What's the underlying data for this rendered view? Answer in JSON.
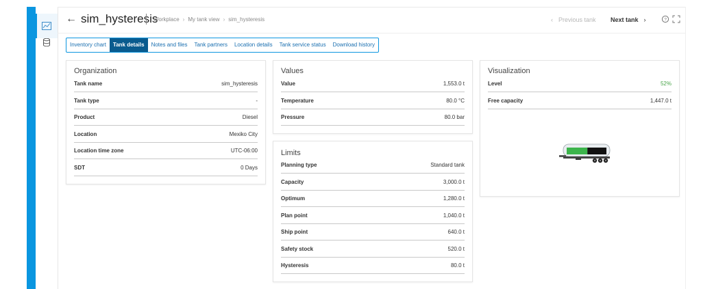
{
  "header": {
    "back_icon": "arrow-left-icon",
    "title": "sim_hysteresis",
    "breadcrumb": [
      "Workplace",
      "My tank view",
      "sim_hysteresis"
    ],
    "prev_label": "Previous tank",
    "next_label": "Next tank",
    "icons": [
      "help-icon",
      "fullscreen-icon"
    ]
  },
  "rail": {
    "icons": [
      "chart-icon",
      "database-icon"
    ]
  },
  "tabs": [
    {
      "label": "Inventory chart",
      "active": false
    },
    {
      "label": "Tank details",
      "active": true
    },
    {
      "label": "Notes and files",
      "active": false
    },
    {
      "label": "Tank partners",
      "active": false
    },
    {
      "label": "Location details",
      "active": false
    },
    {
      "label": "Tank service status",
      "active": false
    },
    {
      "label": "Download history",
      "active": false
    }
  ],
  "organization": {
    "title": "Organization",
    "rows": [
      {
        "label": "Tank name",
        "value": "sim_hysteresis"
      },
      {
        "label": "Tank type",
        "value": "-"
      },
      {
        "label": "Product",
        "value": "Diesel"
      },
      {
        "label": "Location",
        "value": "Mexiko City"
      },
      {
        "label": "Location time zone",
        "value": "UTC-06:00"
      },
      {
        "label": "SDT",
        "value": "0 Days"
      }
    ]
  },
  "values": {
    "title": "Values",
    "rows": [
      {
        "label": "Value",
        "value": "1,553.0 t"
      },
      {
        "label": "Temperature",
        "value": "80.0 °C"
      },
      {
        "label": "Pressure",
        "value": "80.0 bar"
      }
    ]
  },
  "limits": {
    "title": "Limits",
    "rows": [
      {
        "label": "Planning type",
        "value": "Standard tank"
      },
      {
        "label": "Capacity",
        "value": "3,000.0 t"
      },
      {
        "label": "Optimum",
        "value": "1,280.0 t"
      },
      {
        "label": "Plan point",
        "value": "1,040.0 t"
      },
      {
        "label": "Ship point",
        "value": "640.0 t"
      },
      {
        "label": "Safety stock",
        "value": "520.0 t"
      },
      {
        "label": "Hysteresis",
        "value": "80.0 t"
      }
    ]
  },
  "visualization": {
    "title": "Visualization",
    "rows": [
      {
        "label": "Level",
        "value": "52%"
      },
      {
        "label": "Free capacity",
        "value": "1,447.0 t"
      }
    ],
    "level_fraction": 0.52,
    "tank_icon": "tank-trailer-icon",
    "colors": {
      "level_fill": "#3cb44b",
      "level_text": "#47a447",
      "accent": "#0a96e0"
    }
  }
}
